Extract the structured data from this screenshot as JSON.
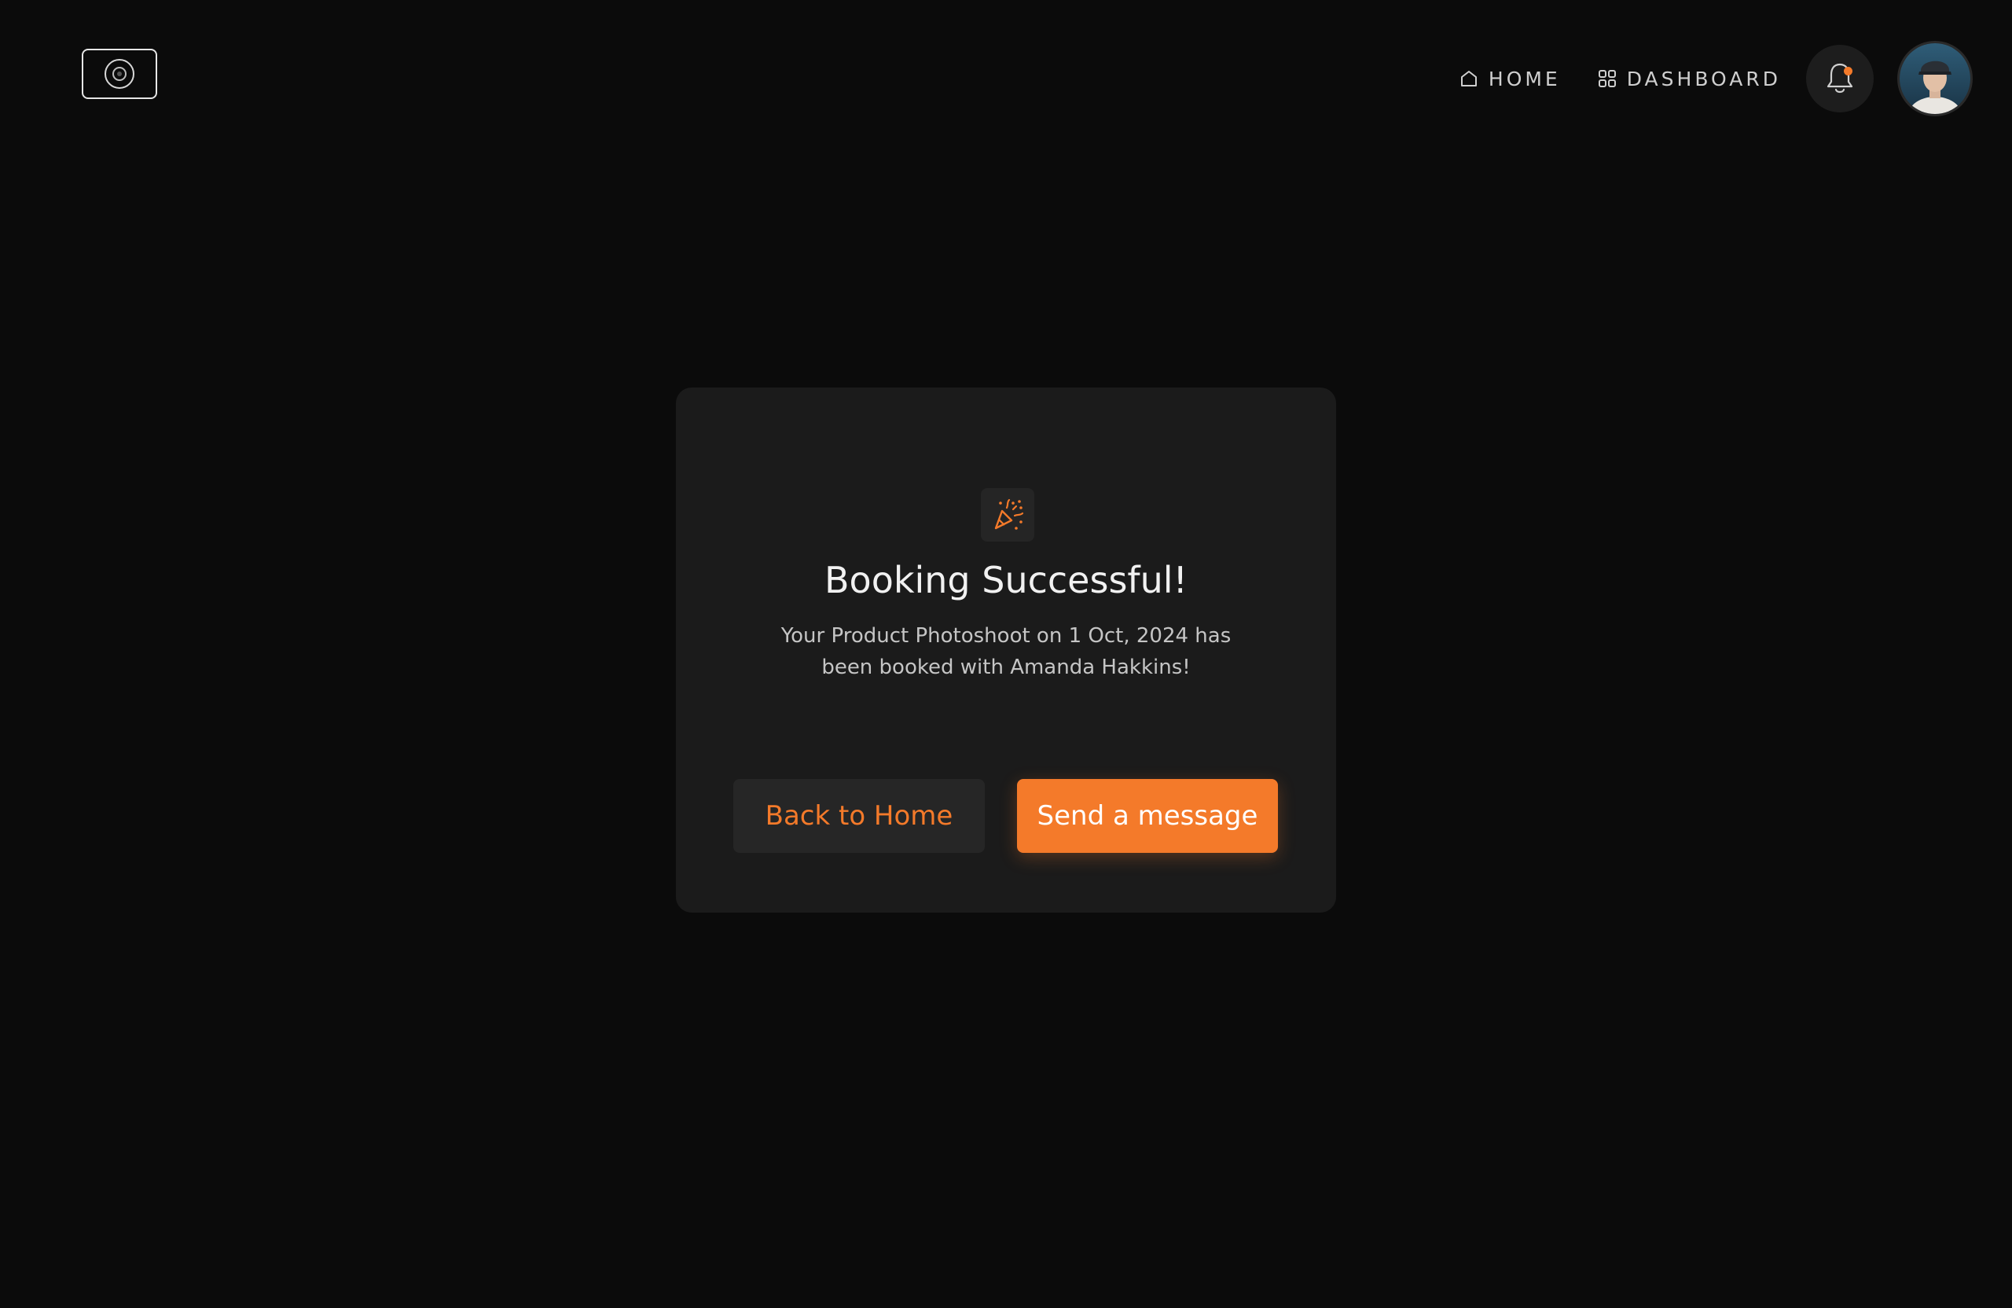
{
  "header": {
    "logo_icon": "camera-lens-icon",
    "nav": [
      {
        "label": "HOME",
        "icon": "home-icon"
      },
      {
        "label": "DASHBOARD",
        "icon": "grid-icon"
      }
    ],
    "notification_icon": "bell-icon",
    "has_unread_notification": true,
    "avatar_icon": "user-avatar"
  },
  "card": {
    "icon": "party-popper-icon",
    "title": "Booking Successful!",
    "message": "Your Product Photoshoot on 1 Oct, 2024 has been booked with Amanda Hakkins!",
    "back_button": "Back to Home",
    "send_button": "Send a message"
  },
  "colors": {
    "background": "#0b0b0b",
    "card": "#1b1b1b",
    "accent": "#f47a2a"
  }
}
